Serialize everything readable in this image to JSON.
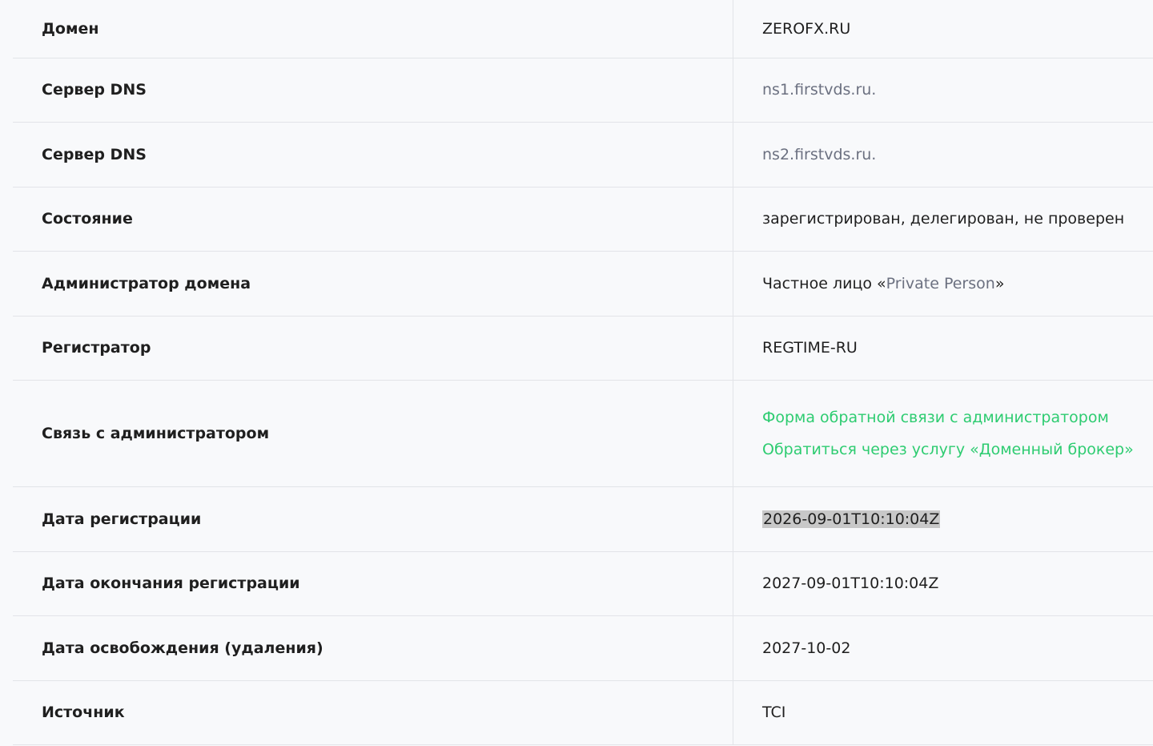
{
  "rows": [
    {
      "label": "Домен",
      "value": "ZEROFX.RU"
    },
    {
      "label": "Сервер DNS",
      "value": "ns1.firstvds.ru."
    },
    {
      "label": "Сервер DNS",
      "value": "ns2.firstvds.ru."
    },
    {
      "label": "Состояние",
      "value": "зарегистрирован, делегирован, не проверен"
    },
    {
      "label": "Администратор домена",
      "value_prefix": "Частное лицо «",
      "value_link": "Private Person",
      "value_suffix": "»"
    },
    {
      "label": "Регистратор",
      "value": "REGTIME-RU"
    },
    {
      "label": "Связь с администратором",
      "links": [
        "Форма обратной связи с администратором",
        "Обратиться через услугу «Доменный брокер»"
      ]
    },
    {
      "label": "Дата регистрации",
      "value": "2026-09-01T10:10:04Z"
    },
    {
      "label": "Дата окончания регистрации",
      "value": "2027-09-01T10:10:04Z"
    },
    {
      "label": "Дата освобождения (удаления)",
      "value": "2027-10-02"
    },
    {
      "label": "Источник",
      "value": "TCI"
    }
  ],
  "colors": {
    "link": "#2ecc71",
    "muted": "#6b7080",
    "background": "#f8f9fb",
    "border": "#e2e4e8"
  }
}
